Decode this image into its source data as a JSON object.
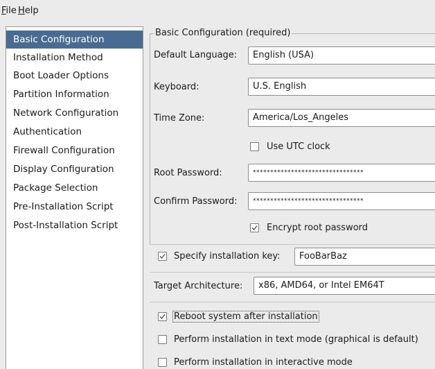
{
  "menu": {
    "file": {
      "mnemonic": "F",
      "rest": "ile"
    },
    "help": {
      "mnemonic": "H",
      "rest": "elp"
    }
  },
  "sidebar": {
    "items": [
      {
        "label": "Basic Configuration"
      },
      {
        "label": "Installation Method"
      },
      {
        "label": "Boot Loader Options"
      },
      {
        "label": "Partition Information"
      },
      {
        "label": "Network Configuration"
      },
      {
        "label": "Authentication"
      },
      {
        "label": "Firewall Configuration"
      },
      {
        "label": "Display Configuration"
      },
      {
        "label": "Package Selection"
      },
      {
        "label": "Pre-Installation Script"
      },
      {
        "label": "Post-Installation Script"
      }
    ],
    "selected_index": 0
  },
  "basic": {
    "frame_title": "Basic Configuration (required)",
    "default_language": {
      "label": "Default Language:",
      "value": "English (USA)"
    },
    "keyboard": {
      "label": "Keyboard:",
      "value": "U.S. English"
    },
    "time_zone": {
      "label": "Time Zone:",
      "value": "America/Los_Angeles"
    },
    "use_utc": {
      "label": "Use UTC clock",
      "checked": false
    },
    "root_password": {
      "label": "Root Password:",
      "value": "********************************"
    },
    "confirm_password": {
      "label": "Confirm Password:",
      "value": "********************************"
    },
    "encrypt_root": {
      "label": "Encrypt root password",
      "checked": true
    }
  },
  "install_key": {
    "label": "Specify installation key:",
    "checked": true,
    "value": "FooBarBaz"
  },
  "target_arch": {
    "label": "Target Architecture:",
    "value": "x86, AMD64, or Intel EM64T"
  },
  "options": {
    "reboot": {
      "label": "Reboot system after installation",
      "checked": true
    },
    "text_mode": {
      "label": "Perform installation in text mode (graphical is default)",
      "checked": false
    },
    "interactive": {
      "label": "Perform installation in interactive mode",
      "checked": false
    }
  },
  "colors": {
    "selection": "#4a6b91",
    "window": "#ebebeb"
  }
}
